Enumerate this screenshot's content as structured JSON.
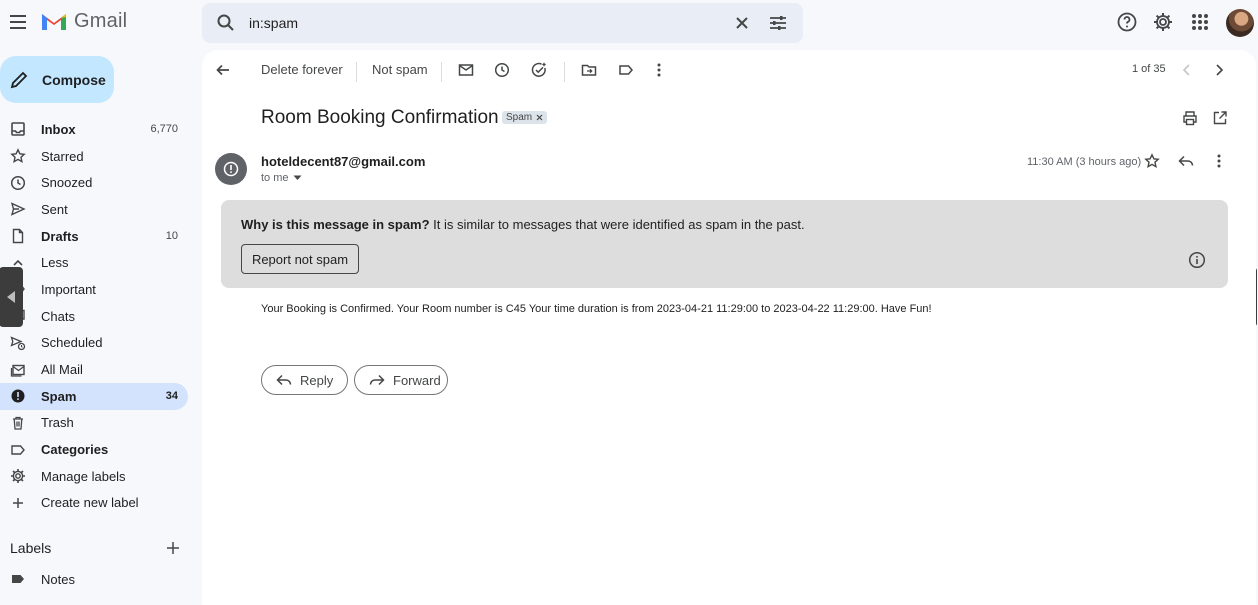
{
  "app": {
    "name": "Gmail"
  },
  "search": {
    "query": "in:spam"
  },
  "compose": {
    "label": "Compose"
  },
  "nav": [
    {
      "label": "Inbox",
      "count": "6,770",
      "icon": "inbox-icon"
    },
    {
      "label": "Starred",
      "count": "",
      "icon": "star-icon"
    },
    {
      "label": "Snoozed",
      "count": "",
      "icon": "clock-icon"
    },
    {
      "label": "Sent",
      "count": "",
      "icon": "send-icon"
    },
    {
      "label": "Drafts",
      "count": "10",
      "icon": "file-icon"
    },
    {
      "label": "Less",
      "count": "",
      "icon": "chevron-up-icon"
    },
    {
      "label": "Important",
      "count": "",
      "icon": "label-important-icon"
    },
    {
      "label": "Chats",
      "count": "",
      "icon": "chat-icon"
    },
    {
      "label": "Scheduled",
      "count": "",
      "icon": "scheduled-send-icon"
    },
    {
      "label": "All Mail",
      "count": "",
      "icon": "all-mail-icon"
    },
    {
      "label": "Spam",
      "count": "34",
      "icon": "spam-icon"
    },
    {
      "label": "Trash",
      "count": "",
      "icon": "trash-icon"
    },
    {
      "label": "Categories",
      "count": "",
      "icon": "label-icon"
    },
    {
      "label": "Manage labels",
      "count": "",
      "icon": "gear-icon"
    },
    {
      "label": "Create new label",
      "count": "",
      "icon": "plus-icon"
    }
  ],
  "labels": {
    "title": "Labels",
    "items": [
      {
        "label": "Notes"
      }
    ]
  },
  "toolbar": {
    "delete_forever": "Delete forever",
    "not_spam": "Not spam",
    "pager": "1 of 35"
  },
  "email": {
    "subject": "Room Booking Confirmation",
    "tag": "Spam",
    "sender": "hoteldecent87@gmail.com",
    "to": "to me",
    "time": "11:30 AM (3 hours ago)",
    "spam_why_bold": "Why is this message in spam?",
    "spam_why_rest": " It is similar to messages that were identified as spam in the past.",
    "report_label": "Report not spam",
    "body": "Your Booking is Confirmed. Your Room number is C45 Your time duration is from 2023-04-21 11:29:00 to 2023-04-22 11:29:00. Have Fun!",
    "reply_label": "Reply",
    "forward_label": "Forward"
  },
  "colors": {
    "active_nav": "#d3e3fd",
    "compose": "#c2e7ff",
    "search_bg": "#e9eef6",
    "spam_banner": "#dddddd"
  }
}
